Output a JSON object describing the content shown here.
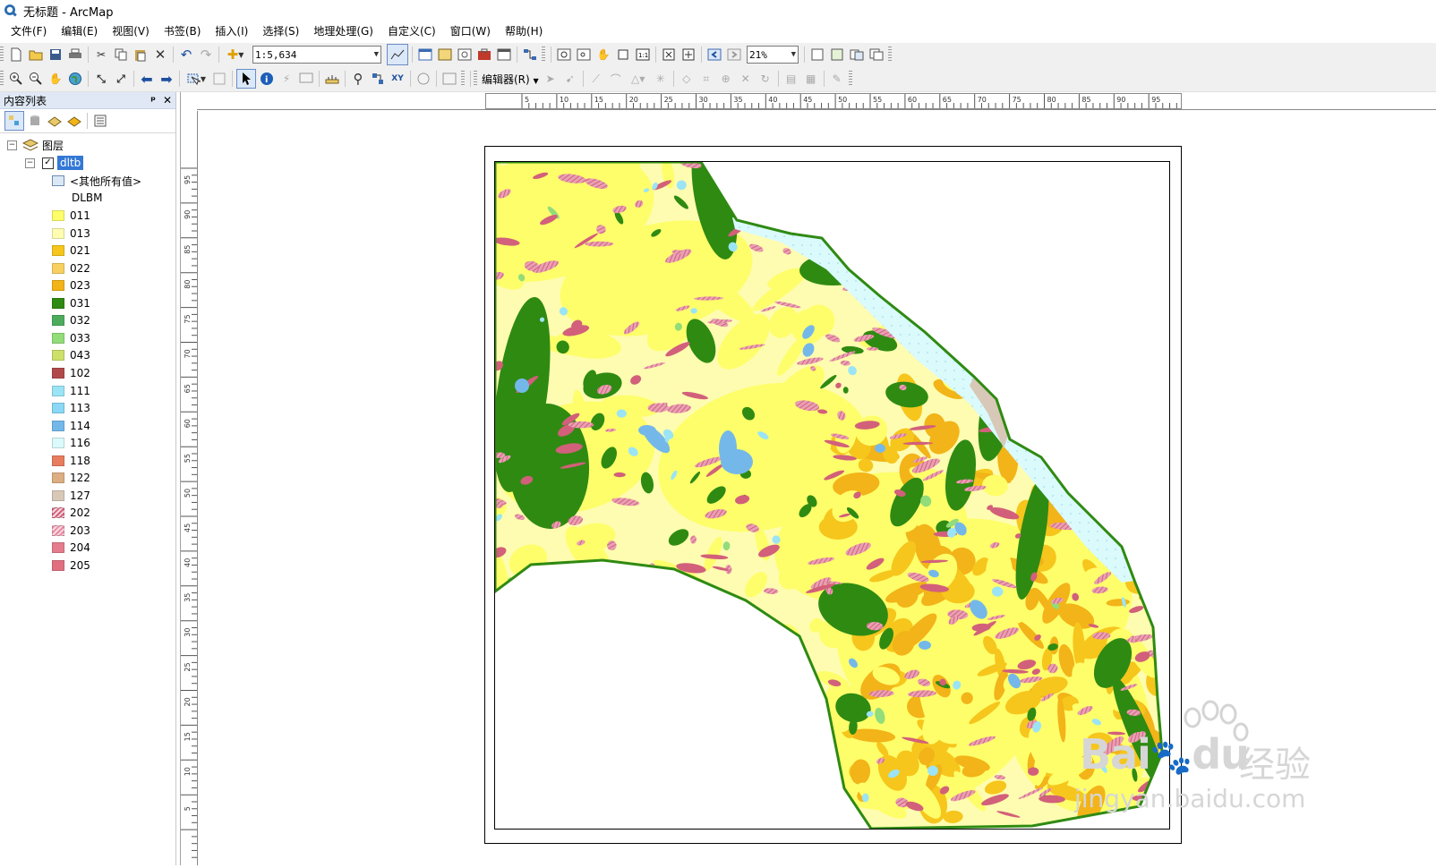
{
  "window": {
    "title": "无标题 - ArcMap"
  },
  "menu": {
    "items": [
      "文件(F)",
      "编辑(E)",
      "视图(V)",
      "书签(B)",
      "插入(I)",
      "选择(S)",
      "地理处理(G)",
      "自定义(C)",
      "窗口(W)",
      "帮助(H)"
    ]
  },
  "toolbar": {
    "scale_value": "1:5,634",
    "zoom_value": "21%",
    "editor_label": "编辑器(R)"
  },
  "toc": {
    "title": "内容列表",
    "pin": "ᵖ",
    "close": "✕",
    "root_label": "图层",
    "layer_name": "dltb",
    "other_values_label": "<其他所有值>",
    "field_label": "DLBM",
    "legend": [
      {
        "code": "011",
        "color": "#fefe6a"
      },
      {
        "code": "013",
        "color": "#fefcb0"
      },
      {
        "code": "021",
        "color": "#f6c61c"
      },
      {
        "code": "022",
        "color": "#f8d060"
      },
      {
        "code": "023",
        "color": "#f2b418"
      },
      {
        "code": "031",
        "color": "#2f8a12"
      },
      {
        "code": "032",
        "color": "#4cac5c"
      },
      {
        "code": "033",
        "color": "#92dc7a"
      },
      {
        "code": "043",
        "color": "#cde06a"
      },
      {
        "code": "102",
        "color": "#b04a4a"
      },
      {
        "code": "111",
        "color": "#9be4f6"
      },
      {
        "code": "113",
        "color": "#8ad8f6"
      },
      {
        "code": "114",
        "color": "#74b8ea"
      },
      {
        "code": "116",
        "color": "#dafafc"
      },
      {
        "code": "118",
        "color": "#e87c5e"
      },
      {
        "code": "122",
        "color": "#dcae82"
      },
      {
        "code": "127",
        "color": "#d8c8b8"
      },
      {
        "code": "202",
        "color": "#d2607a"
      },
      {
        "code": "203",
        "color": "#e88aa2"
      },
      {
        "code": "204",
        "color": "#e47c8e"
      },
      {
        "code": "205",
        "color": "#e07080"
      }
    ]
  },
  "rulers": {
    "horizontal": [
      "5",
      "10",
      "15",
      "20",
      "25",
      "30",
      "35",
      "40",
      "45",
      "50",
      "55",
      "60",
      "65",
      "70",
      "75",
      "80",
      "85",
      "90",
      "95"
    ],
    "vertical": [
      "95",
      "90",
      "85",
      "80",
      "75",
      "70",
      "65",
      "60",
      "55",
      "50",
      "45",
      "40",
      "35",
      "30",
      "25",
      "20",
      "15",
      "10",
      "5"
    ]
  },
  "watermark": {
    "brand": "Bai",
    "brand2": "du",
    "cn": "经验",
    "url": "jingyan.baidu.com"
  }
}
